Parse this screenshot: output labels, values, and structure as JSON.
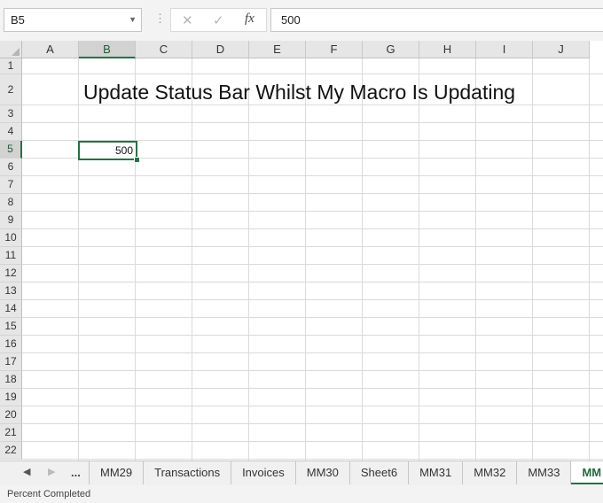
{
  "formula_bar": {
    "name_box": "B5",
    "cancel_icon": "✕",
    "enter_icon": "✓",
    "fx_label": "fx",
    "formula_value": "500"
  },
  "columns": [
    "A",
    "B",
    "C",
    "D",
    "E",
    "F",
    "G",
    "H",
    "I",
    "J"
  ],
  "rows": [
    "1",
    "2",
    "3",
    "4",
    "5",
    "6",
    "7",
    "8",
    "9",
    "10",
    "11",
    "12",
    "13",
    "14",
    "15",
    "16",
    "17",
    "18",
    "19",
    "20",
    "21",
    "22"
  ],
  "selected_column": "B",
  "selected_row": "5",
  "cells": {
    "title": "Update Status Bar Whilst My Macro Is Updating",
    "B5": "500"
  },
  "sheet_tabs": {
    "ellipsis": "...",
    "tabs": [
      "MM29",
      "Transactions",
      "Invoices",
      "MM30",
      "Sheet6",
      "MM31",
      "MM32",
      "MM33",
      "MM"
    ],
    "active_tab": "MM"
  },
  "status_bar": {
    "text": "Percent Completed"
  },
  "colors": {
    "accent": "#217346"
  }
}
